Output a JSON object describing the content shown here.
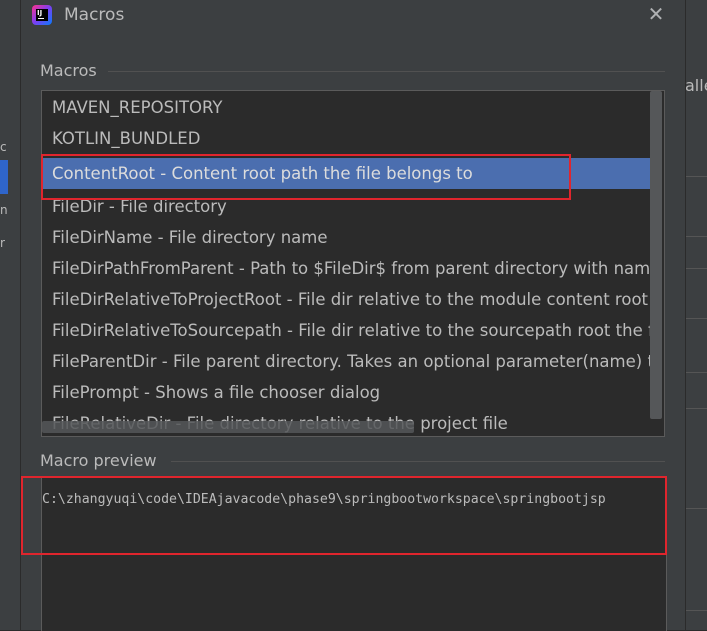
{
  "dialog": {
    "title": "Macros",
    "close_glyph": "✕"
  },
  "macros_section": {
    "label": "Macros",
    "items": [
      "MAVEN_REPOSITORY",
      "KOTLIN_BUNDLED",
      "ContentRoot - Content root path the file belongs to",
      "FileDir - File directory",
      "FileDirName - File directory name",
      "FileDirPathFromParent - Path to $FileDir$ from parent directory with name p",
      "FileDirRelativeToProjectRoot - File dir relative to the module content root t",
      "FileDirRelativeToSourcepath - File dir relative to the sourcepath root the file",
      "FileParentDir - File parent directory. Takes an optional parameter(name) to f",
      "FilePrompt - Shows a file chooser dialog",
      "FileRelativeDir - File directory relative to the project file"
    ],
    "selected_index": 2
  },
  "preview_section": {
    "label": "Macro preview",
    "text": "C:\\zhangyuqi\\code\\IDEAjavacode\\phase9\\springbootworkspace\\springbootjsp"
  },
  "background": {
    "right_fragment": "alle",
    "left_fragments": [
      "c",
      "n",
      "r"
    ]
  },
  "colors": {
    "dialog_bg": "#3c3f41",
    "list_bg": "#2b2b2b",
    "selection": "#4b6eaf",
    "annotation_red": "#e0252d"
  },
  "icons": {
    "app": "intellij-idea-icon",
    "close": "close-icon"
  }
}
